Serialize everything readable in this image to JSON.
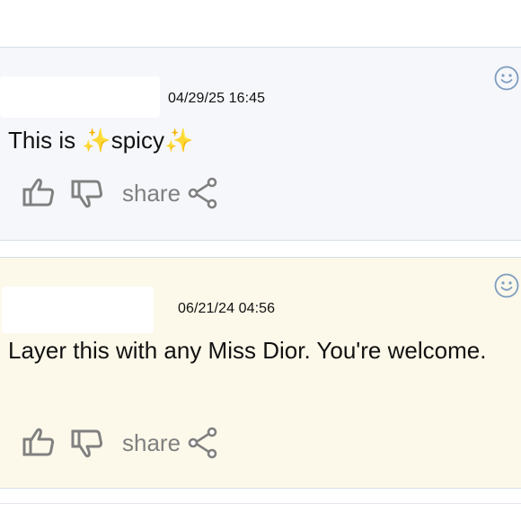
{
  "comments": [
    {
      "date": "04/29/25 16:45",
      "text": "This is ✨spicy✨",
      "actions": {
        "share_label": "share"
      }
    },
    {
      "date": "06/21/24 04:56",
      "text": "Layer this with any Miss Dior. You're welcome.",
      "actions": {
        "share_label": "share"
      }
    }
  ],
  "icons": {
    "like": "thumbs-up-icon",
    "dislike": "thumbs-down-icon",
    "share": "share-icon",
    "reaction": "smiley-icon"
  },
  "colors": {
    "comment1_bg": "#f6f7fa",
    "comment2_bg": "#fcf9ea",
    "divider": "#d6dee6",
    "icon_gray": "#808080",
    "smiley_blue": "#7d9cc0"
  }
}
